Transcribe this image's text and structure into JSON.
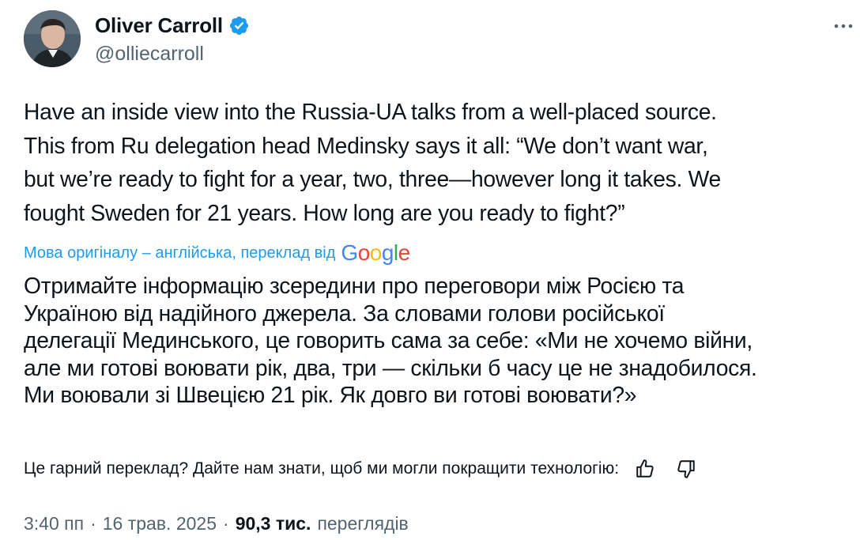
{
  "author": {
    "display_name": "Oliver Carroll",
    "handle": "@olliecarroll",
    "verified": true,
    "avatar_icon": "profile-photo"
  },
  "more_icon": "ellipsis-icon",
  "tweet": {
    "text": "Have an inside view into the Russia-UA talks from a well-placed source.\nThis from Ru delegation head Medinsky says it all: “We don’t want war,\nbut we’re ready to fight for a year, two, three—however long it takes. We\nfought Sweden for 21 years. How long are you ready to fight?”"
  },
  "translation": {
    "note": "Мова оригіналу – англійська, переклад від",
    "provider": "Google",
    "text": "Отримайте інформацію зсередини про переговори між Росією та\nУкраїною від надійного джерела. За словами голови російської\nделегації Мединського, це говорить сама за себе: «Ми не хочемо війни,\nале ми готові воювати рік, два, три — скільки б часу це не знадобилося.\nМи воювали зі Швецією 21 рік. Як довго ви готові воювати?»",
    "feedback_prompt": "Це гарний переклад? Дайте нам знати, щоб ми могли покращити технологію:"
  },
  "meta": {
    "time": "3:40 пп",
    "separator": "·",
    "date": "16 трав. 2025",
    "views_count": "90,3 тис.",
    "views_label": "переглядів"
  },
  "colors": {
    "accent": "#1d9bf0",
    "text": "#0f1419",
    "secondary": "#536471",
    "google_blue": "#4285f4",
    "google_red": "#ea4335",
    "google_yellow": "#fbbc05",
    "google_green": "#34a853"
  }
}
